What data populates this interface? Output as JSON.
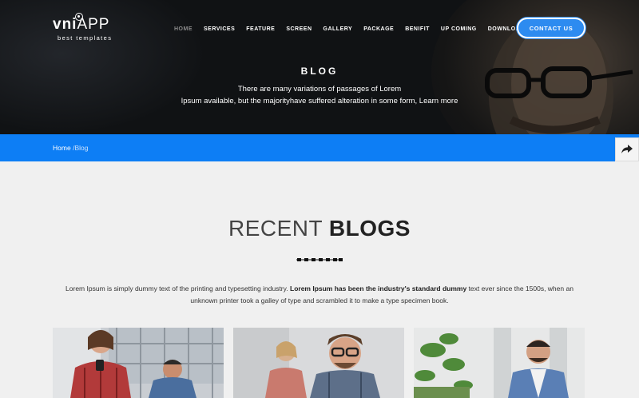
{
  "logo": {
    "bold": "vni",
    "thin": "APP",
    "tagline": "best templates"
  },
  "nav": {
    "items": [
      "HOME",
      "SERVICES",
      "FEATURE",
      "SCREEN",
      "GALLERY",
      "PACKAGE",
      "BENIFIT",
      "UP COMING",
      "DOWNLOAD APP"
    ],
    "active_index": 0
  },
  "contact_button": "CONTACT US",
  "hero": {
    "title": "BLOG",
    "text_line1": "There are many variations of passages of Lorem",
    "text_line2": "Ipsum available, but the majorityhave suffered alteration in some form, Learn more"
  },
  "breadcrumb": {
    "home": "Home",
    "separator": "/",
    "current": "Blog"
  },
  "section": {
    "title_light": "RECENT",
    "title_bold": "BLOGS",
    "intro_start": "Lorem Ipsum is simply dummy text of the printing and typesetting industry.",
    "intro_bold": "Lorem Ipsum has been the industry's standard dummy",
    "intro_end": "text ever since the 1500s, when an unknown printer took a galley of type and scrambled it to make a type specimen book."
  },
  "cards": [
    {
      "image": "woman-with-phone-and-man-photo"
    },
    {
      "image": "smiling-man-with-glasses-photo"
    },
    {
      "image": "man-with-plants-photo"
    }
  ],
  "colors": {
    "accent": "#0d7ef5",
    "hero_bg": "#101214",
    "page_bg": "#f0f0f0"
  },
  "icons": {
    "share": "share-arrow-icon"
  }
}
